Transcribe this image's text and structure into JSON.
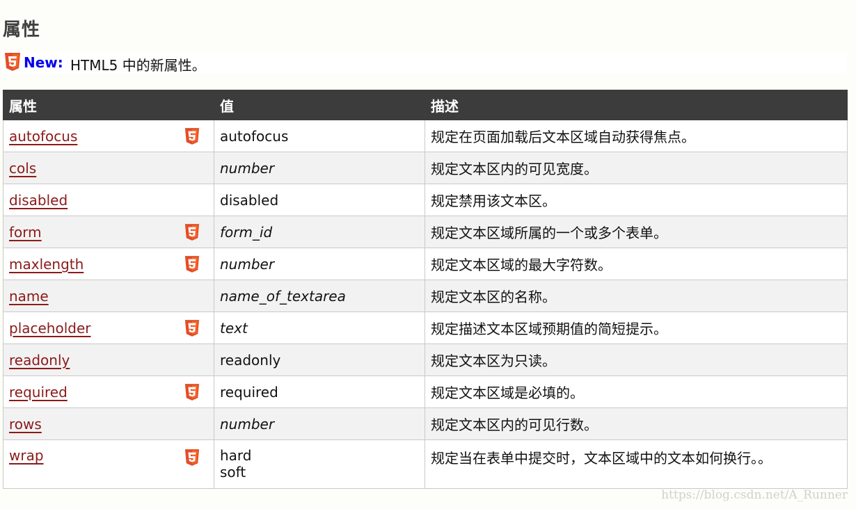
{
  "heading": "属性",
  "note": {
    "label": "New:",
    "text": "HTML5 中的新属性。"
  },
  "table": {
    "headers": [
      "属性",
      "值",
      "描述"
    ],
    "rows": [
      {
        "attr": "autofocus",
        "value": "autofocus",
        "desc": "规定在页面加载后文本区域自动获得焦点。",
        "html5": true
      },
      {
        "attr": "cols",
        "value": "number",
        "desc": "规定文本区内的可见宽度。",
        "html5": false
      },
      {
        "attr": "disabled",
        "value": "disabled",
        "desc": "规定禁用该文本区。",
        "html5": false
      },
      {
        "attr": "form",
        "value": "form_id",
        "desc": "规定文本区域所属的一个或多个表单。",
        "html5": true
      },
      {
        "attr": "maxlength",
        "value": "number",
        "desc": "规定文本区域的最大字符数。",
        "html5": true
      },
      {
        "attr": "name",
        "value": "name_of_textarea",
        "desc": "规定文本区的名称。",
        "html5": false
      },
      {
        "attr": "placeholder",
        "value": "text",
        "desc": "规定描述文本区域预期值的简短提示。",
        "html5": true
      },
      {
        "attr": "readonly",
        "value": "readonly",
        "desc": "规定文本区为只读。",
        "html5": false
      },
      {
        "attr": "required",
        "value": "required",
        "desc": "规定文本区域是必填的。",
        "html5": true
      },
      {
        "attr": "rows",
        "value": "number",
        "desc": "规定文本区内的可见行数。",
        "html5": false
      },
      {
        "attr": "wrap",
        "value": "hard",
        "value2": "soft",
        "desc": "规定当在表单中提交时，文本区域中的文本如何换行。。",
        "html5": true
      }
    ]
  },
  "watermark": "https://blog.csdn.net/A_Runner",
  "icons": {
    "html5_badge": "html5-icon"
  },
  "colors": {
    "header_bg": "#3c3c3c",
    "link": "#8b1a1a",
    "new_label": "#0000ee",
    "html5_badge": "#e44d26"
  }
}
